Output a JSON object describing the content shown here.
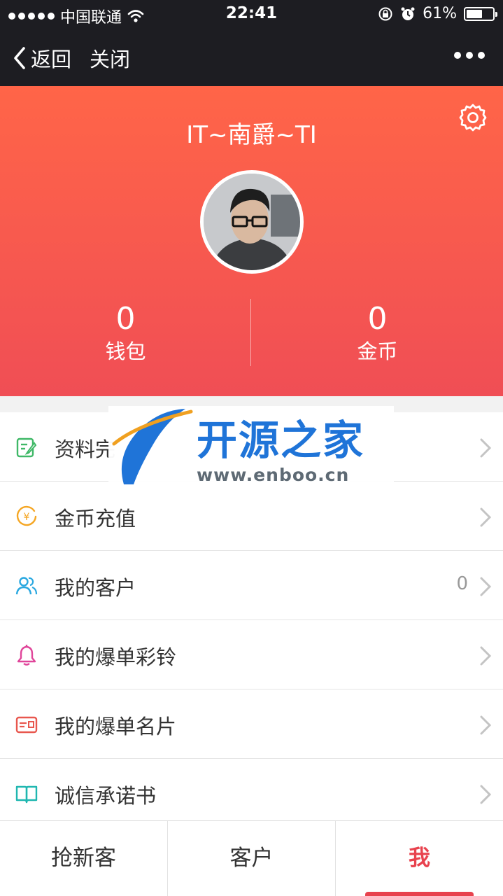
{
  "status_bar": {
    "carrier": "中国联通",
    "time": "22:41",
    "battery_percent": "61%",
    "battery_level": 0.61
  },
  "nav": {
    "back_label": "返回",
    "close_label": "关闭",
    "more_icon": "more-icon"
  },
  "profile": {
    "username": "IT~南爵~TI",
    "wallet": {
      "value": "0",
      "label": "钱包"
    },
    "coins": {
      "value": "0",
      "label": "金币"
    }
  },
  "menu": {
    "items": [
      {
        "label": "资料完",
        "icon": "edit-profile-icon",
        "count": ""
      },
      {
        "label": "金币充值",
        "icon": "coin-icon",
        "count": ""
      },
      {
        "label": "我的客户",
        "icon": "customers-icon",
        "count": "0"
      },
      {
        "label": "我的爆单彩铃",
        "icon": "bell-icon",
        "count": ""
      },
      {
        "label": "我的爆单名片",
        "icon": "card-icon",
        "count": ""
      },
      {
        "label": "诚信承诺书",
        "icon": "book-icon",
        "count": ""
      }
    ]
  },
  "watermark": {
    "title": "开源之家",
    "url": "www.enboo.cn"
  },
  "tabs": [
    {
      "label": "抢新客",
      "active": false
    },
    {
      "label": "客户",
      "active": false
    },
    {
      "label": "我",
      "active": true
    }
  ],
  "colors": {
    "accent": "#e8424e",
    "header_top": "#ff6548",
    "header_bottom": "#f04e55",
    "bar": "#1d1d22"
  }
}
